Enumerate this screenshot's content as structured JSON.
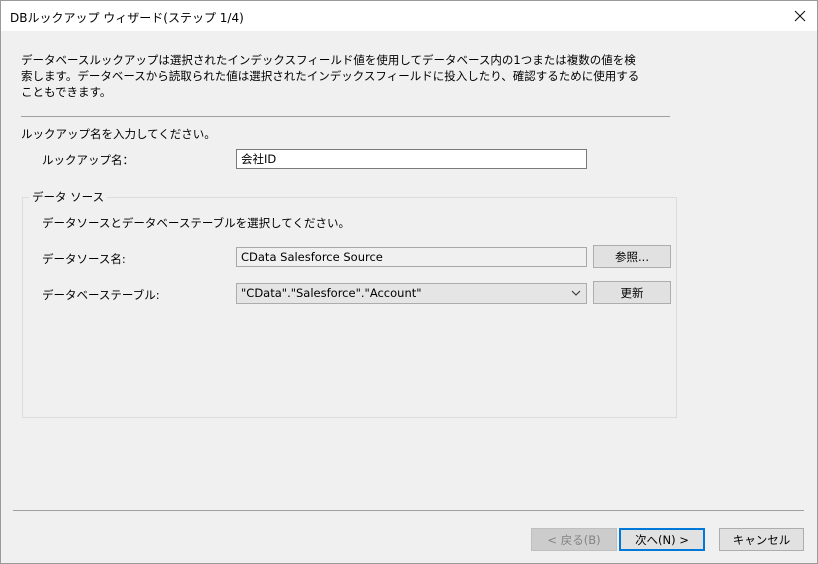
{
  "window": {
    "title": "DBルックアップ ウィザード(ステップ 1/4)",
    "close_icon": "close-icon"
  },
  "description": "データベースルックアップは選択されたインデックスフィールド値を使用してデータベース内の1つまたは複数の値を検索します。データベースから読取られた値は選択されたインデックスフィールドに投入したり、確認するために使用することもできます。",
  "lookup": {
    "prompt": "ルックアップ名を入力してください。",
    "name_label": "ルックアップ名：",
    "name_value": "会社ID"
  },
  "datasource": {
    "group_title": "データ ソース",
    "prompt": "データソースとデータベーステーブルを選択してください。",
    "source_label": "データソース名:",
    "source_value": "CData Salesforce Source",
    "browse_button": "参照...",
    "table_label": "データベーステーブル:",
    "table_value": "\"CData\".\"Salesforce\".\"Account\"",
    "refresh_button": "更新"
  },
  "footer": {
    "back_button": "< 戻る(B)",
    "next_button": "次へ(N) >",
    "cancel_button": "キャンセル"
  }
}
